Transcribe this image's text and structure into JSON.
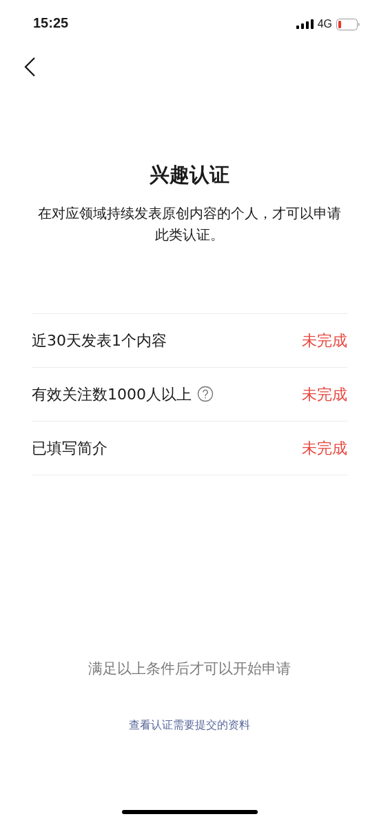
{
  "status_bar": {
    "time": "15:25",
    "network": "4G"
  },
  "title": "兴趣认证",
  "description": "在对应领域持续发表原创内容的个人，才可以申请此类认证。",
  "requirements": [
    {
      "label": "近30天发表1个内容",
      "help": false,
      "status": "未完成",
      "completed": false
    },
    {
      "label": "有效关注数1000人以上",
      "help": true,
      "status": "未完成",
      "completed": false
    },
    {
      "label": "已填写简介",
      "help": false,
      "status": "未完成",
      "completed": false
    }
  ],
  "notice": "满足以上条件后才可以开始申请",
  "link": "查看认证需要提交的资料"
}
